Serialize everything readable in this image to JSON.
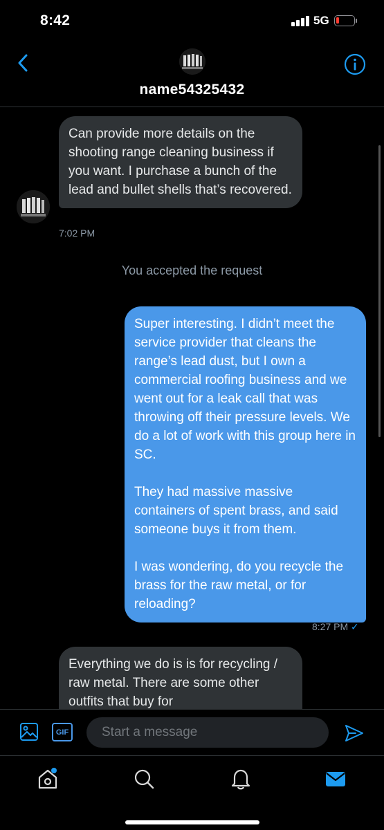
{
  "status_bar": {
    "time": "8:42",
    "network": "5G"
  },
  "header": {
    "username": "name54325432",
    "back_icon": "chevron-left-icon",
    "info_icon": "info-icon"
  },
  "messages": [
    {
      "direction": "incoming",
      "text": "Can provide more details on the shooting range cleaning business if you want. I purchase a bunch of the lead and bullet shells that’s recovered.",
      "timestamp": "7:02 PM"
    },
    {
      "direction": "system",
      "text": "You accepted the request"
    },
    {
      "direction": "outgoing",
      "text": "Super interesting. I didn’t meet the service provider that cleans the range’s lead dust, but I own a commercial roofing business and we went out for a leak call that was throwing off their pressure levels. We do a lot of work with this group here in SC.\n\nThey had massive massive containers of spent brass, and said someone buys it from them.\n\nI was wondering, do you recycle the brass for the raw metal, or for reloading?",
      "timestamp": "8:27 PM",
      "read_receipt": "✓"
    },
    {
      "direction": "incoming",
      "text": "Everything we do is is for recycling / raw metal. There are some other outfits that buy for"
    }
  ],
  "composer": {
    "placeholder": "Start a message",
    "gif_label": "GIF"
  },
  "tabs": [
    {
      "name": "home",
      "icon": "home-icon",
      "has_notification_dot": true
    },
    {
      "name": "search",
      "icon": "search-icon"
    },
    {
      "name": "notifications",
      "icon": "bell-icon"
    },
    {
      "name": "messages",
      "icon": "envelope-icon",
      "active": true
    }
  ],
  "colors": {
    "background": "#000000",
    "incoming_bubble": "#2f3336",
    "outgoing_bubble": "#4a98e9",
    "accent": "#1d9bf0",
    "muted_text": "#8b98a5",
    "battery_low": "#ff3b30"
  }
}
